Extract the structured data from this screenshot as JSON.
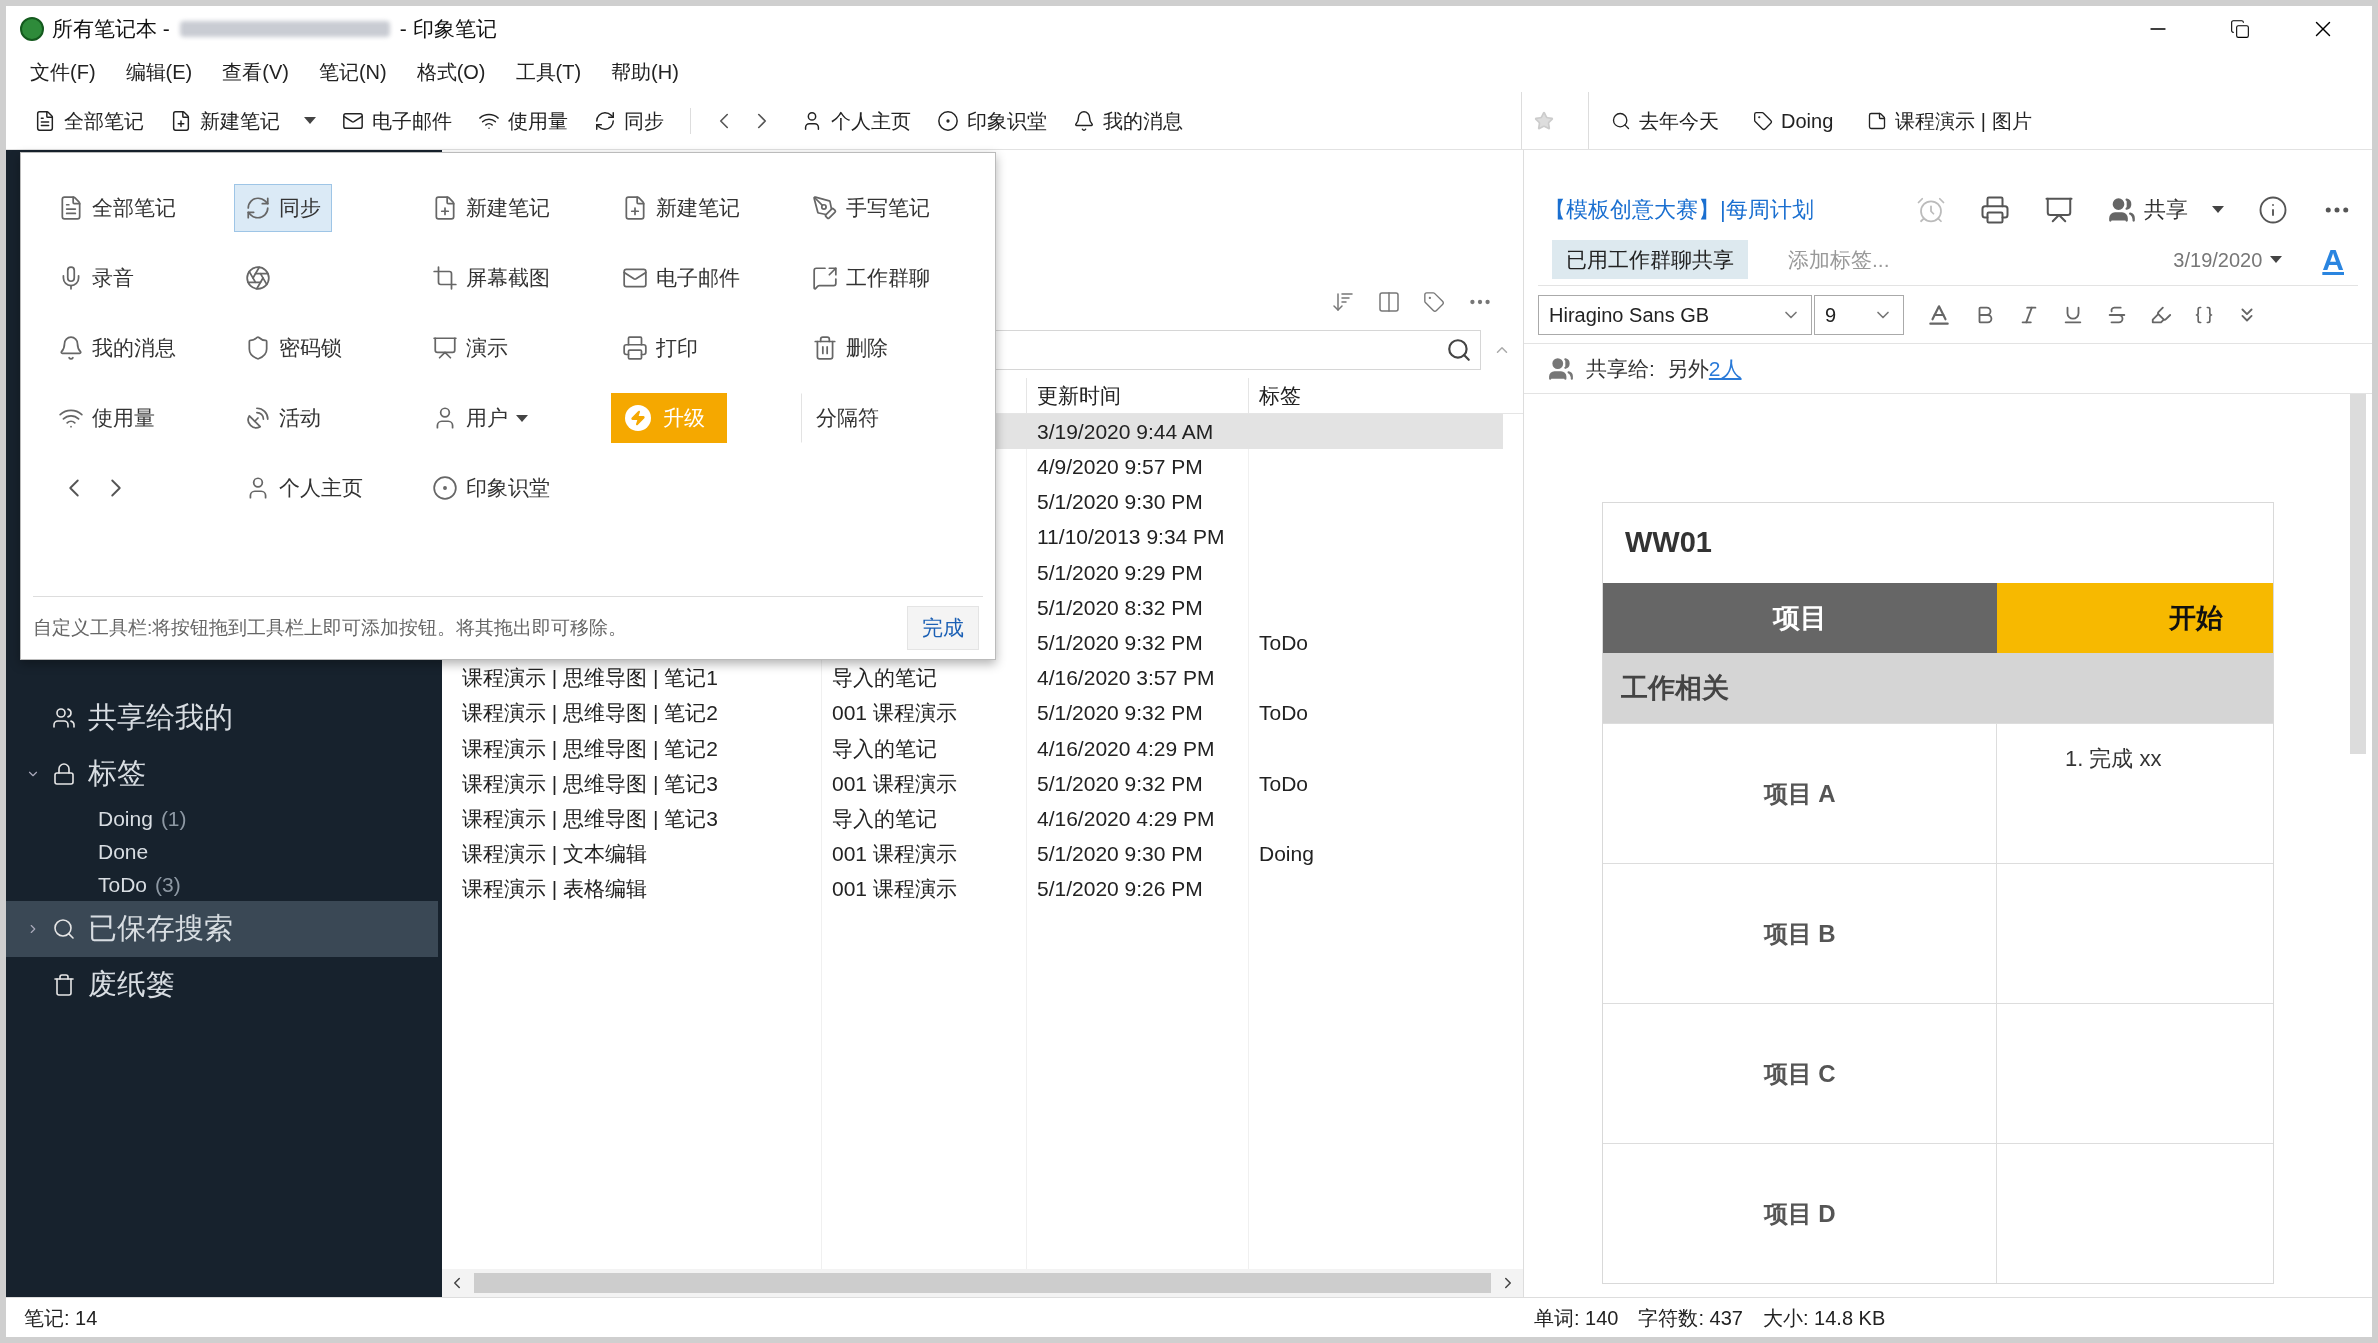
{
  "window": {
    "title_parts": [
      "所有笔记本 -",
      "- 印象笔记"
    ]
  },
  "menu": [
    "文件(F)",
    "编辑(E)",
    "查看(V)",
    "笔记(N)",
    "格式(O)",
    "工具(T)",
    "帮助(H)"
  ],
  "toolbar": {
    "items": [
      {
        "kind": "button",
        "label": "全部笔记"
      },
      {
        "kind": "dropdown",
        "label": "新建笔记"
      },
      {
        "kind": "button",
        "label": "电子邮件"
      },
      {
        "kind": "button",
        "label": "使用量"
      },
      {
        "kind": "button",
        "label": "同步"
      },
      {
        "kind": "nav"
      },
      {
        "kind": "button",
        "label": "个人主页"
      },
      {
        "kind": "button",
        "label": "印象识堂"
      },
      {
        "kind": "button",
        "label": "我的消息"
      }
    ],
    "shortcuts": [
      "去年今天",
      "Doing",
      "课程演示 | 图片"
    ]
  },
  "toolbar_editor": {
    "items": [
      {
        "kind": "button",
        "label": "全部笔记",
        "selected": false
      },
      {
        "kind": "button",
        "label": "同步",
        "selected": true
      },
      {
        "kind": "button",
        "label": "新建笔记",
        "selected": false
      },
      {
        "kind": "button",
        "label": "新建笔记",
        "selected": false
      },
      {
        "kind": "button",
        "label": "手写笔记",
        "selected": false
      },
      {
        "kind": "button",
        "label": "录音",
        "selected": false
      },
      {
        "kind": "button",
        "selected": false
      },
      {
        "kind": "button",
        "label": "屏幕截图",
        "selected": false
      },
      {
        "kind": "button",
        "label": "电子邮件",
        "selected": false
      },
      {
        "kind": "button",
        "label": "工作群聊",
        "selected": false
      },
      {
        "kind": "button",
        "label": "我的消息",
        "selected": false
      },
      {
        "kind": "button",
        "label": "密码锁",
        "selected": false
      },
      {
        "kind": "button",
        "label": "演示",
        "selected": false
      },
      {
        "kind": "button",
        "label": "打印",
        "selected": false
      },
      {
        "kind": "button",
        "label": "删除",
        "selected": false
      },
      {
        "kind": "button",
        "label": "使用量",
        "selected": false
      },
      {
        "kind": "button",
        "label": "活动",
        "selected": false
      },
      {
        "kind": "dropdown",
        "label": "用户",
        "selected": false
      },
      {
        "kind": "upgrade",
        "label": "升级",
        "selected": false
      },
      {
        "kind": "separator",
        "label": "分隔符",
        "selected": false
      },
      {
        "kind": "nav",
        "selected": false
      },
      {
        "kind": "button",
        "label": "个人主页",
        "selected": false
      },
      {
        "kind": "button",
        "label": "印象识堂",
        "selected": false
      }
    ],
    "hint": "自定义工具栏:将按钮拖到工具栏上即可添加按钮。将其拖出即可移除。",
    "done_button": "完成"
  },
  "sidebar": {
    "items": [
      {
        "kind": "shared",
        "label": "共享给我的",
        "selected": false
      },
      {
        "kind": "tags",
        "label": "标签",
        "expanded": true,
        "selected": false,
        "children": [
          {
            "label": "Doing",
            "count": "(1)"
          },
          {
            "label": "Done"
          },
          {
            "label": "ToDo",
            "count": "(3)"
          }
        ]
      },
      {
        "kind": "saved",
        "label": "已保存搜索",
        "expanded": false,
        "selected": true
      },
      {
        "kind": "trash",
        "label": "废纸篓",
        "selected": false
      }
    ]
  },
  "note_list": {
    "header": {
      "column_3": "更新时间",
      "column_4": "标签"
    },
    "rows": [
      {
        "updated": "3/19/2020 9:44 AM",
        "selected": true
      },
      {
        "updated": "4/9/2020 9:57 PM",
        "selected": false
      },
      {
        "updated": "5/1/2020 9:30 PM",
        "selected": false
      },
      {
        "updated": "11/10/2013 9:34 PM",
        "selected": false
      },
      {
        "updated": "5/1/2020 9:29 PM",
        "selected": false
      },
      {
        "updated": "5/1/2020 8:32 PM",
        "selected": false
      },
      {
        "updated": "5/1/2020 9:32 PM",
        "tag": "ToDo",
        "selected": false
      },
      {
        "title": "课程演示 | 思维导图 | 笔记1",
        "notebook": "导入的笔记",
        "updated": "4/16/2020 3:57 PM",
        "selected": false
      },
      {
        "title": "课程演示 | 思维导图 | 笔记2",
        "notebook": "001 课程演示",
        "updated": "5/1/2020 9:32 PM",
        "tag": "ToDo",
        "selected": false
      },
      {
        "title": "课程演示 | 思维导图 | 笔记2",
        "notebook": "导入的笔记",
        "updated": "4/16/2020 4:29 PM",
        "selected": false
      },
      {
        "title": "课程演示 | 思维导图 | 笔记3",
        "notebook": "001 课程演示",
        "updated": "5/1/2020 9:32 PM",
        "tag": "ToDo",
        "selected": false
      },
      {
        "title": "课程演示 | 思维导图 | 笔记3",
        "notebook": "导入的笔记",
        "updated": "4/16/2020 4:29 PM",
        "selected": false
      },
      {
        "title": "课程演示 | 文本编辑",
        "notebook": "001 课程演示",
        "updated": "5/1/2020 9:30 PM",
        "tag": "Doing",
        "selected": false
      },
      {
        "title": "课程演示 | 表格编辑",
        "notebook": "001 课程演示",
        "updated": "5/1/2020 9:26 PM",
        "selected": false
      }
    ]
  },
  "note": {
    "title": "【模板创意大赛】|每周计划",
    "share_label": "共享",
    "tag_chip": "已用工作群聊共享",
    "tag_placeholder": "添加标签...",
    "date": "3/19/2020",
    "font_glyph": "A",
    "font": "Hiragino Sans GB",
    "size": "9",
    "shared_with_label": "共享给:",
    "shared_with_text": "另外",
    "shared_with_link": "2人",
    "doc": {
      "heading": "WW01",
      "header": [
        "项目",
        "开始"
      ],
      "section": "工作相关",
      "rows": [
        {
          "label": "项目 A",
          "content": "1. 完成 xx"
        },
        {
          "label": "项目 B"
        },
        {
          "label": "项目 C"
        },
        {
          "label": "项目 D"
        }
      ]
    }
  },
  "status": {
    "left": "笔记: 14",
    "right": [
      "单词: 140",
      "字符数: 437",
      "大小: 14.8 KB"
    ]
  }
}
